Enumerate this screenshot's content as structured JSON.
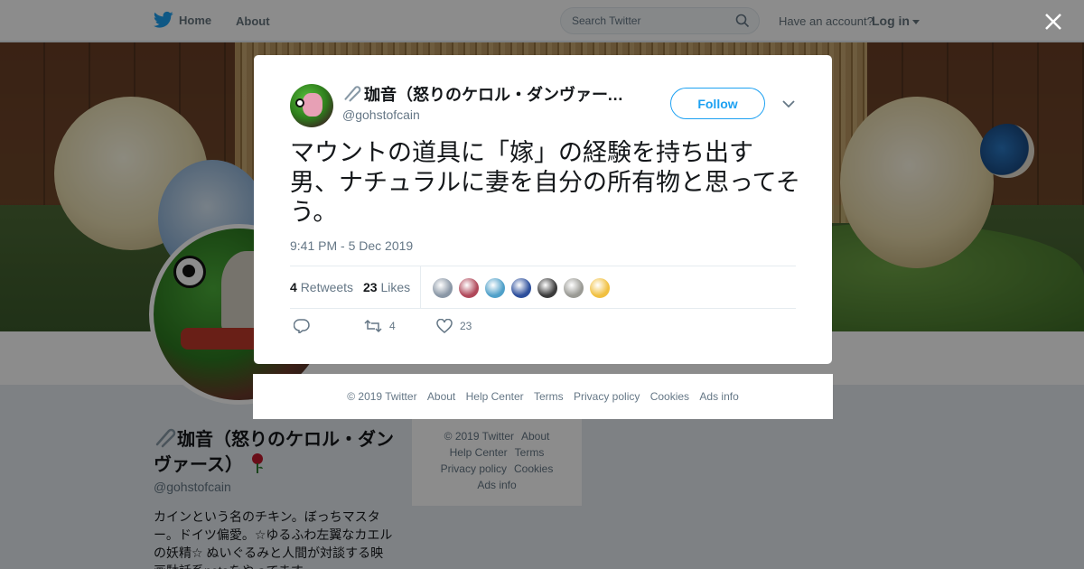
{
  "nav": {
    "home_label": "Home",
    "about_label": "About",
    "search_placeholder": "Search Twitter",
    "have_account": "Have an account?",
    "login_label": "Log in"
  },
  "profile": {
    "name": "珈音（怒りのケロル・ダンヴァース）",
    "handle": "@gohstofcain",
    "bio": "カインという名のチキン。ぼっちマスター。ドイツ偏愛。☆ゆるふわ左翼なカエルの妖精☆ ぬいぐるみと人間が対談する映画駄話系netaをやってます。"
  },
  "bg_footer": {
    "copyright": "© 2019 Twitter",
    "about": "About",
    "help": "Help Center",
    "terms": "Terms",
    "privacy": "Privacy policy",
    "cookies": "Cookies",
    "ads": "Ads info"
  },
  "tweet": {
    "display_name": "珈音（怒りのケロル・ダンヴァース）",
    "handle": "@gohstofcain",
    "follow_label": "Follow",
    "text": "マウントの道具に「嫁」の経験を持ち出す男、ナチュラルに妻を自分の所有物と思ってそう。",
    "timestamp": "9:41 PM - 5 Dec 2019",
    "retweets_count": "4",
    "retweets_label": "Retweets",
    "likes_count": "23",
    "likes_label": "Likes",
    "action_retweets": "4",
    "action_likes": "23",
    "liker_colors": [
      "#8a97a6",
      "#b0485a",
      "#4fa0c9",
      "#2d4f9c",
      "#3b3b3b",
      "#9a9a94",
      "#f1c040"
    ]
  },
  "modal_footer": {
    "copyright": "© 2019 Twitter",
    "about": "About",
    "help": "Help Center",
    "terms": "Terms",
    "privacy": "Privacy policy",
    "cookies": "Cookies",
    "ads": "Ads info"
  },
  "colors": {
    "twitter_blue": "#1da1f2",
    "secondary_text": "#657786"
  },
  "icons": [
    "twitter-bird-icon",
    "search-icon",
    "caret-down-icon",
    "close-icon",
    "paperclip-icon",
    "rose-icon",
    "reply-icon",
    "retweet-icon",
    "heart-icon"
  ]
}
